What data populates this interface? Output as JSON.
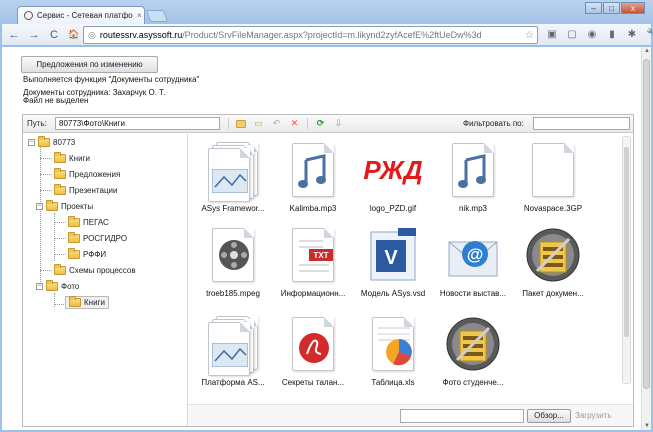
{
  "browser": {
    "tab_title": "Сервис - Сетевая платфор",
    "tab_close": "×",
    "url_host": "routessrv.asyssoft.ru",
    "url_path": "/Product/SrvFileManager.aspx?projectId=m.likynd2zyfAcefE%2ftUeDw%3d",
    "back": "←",
    "forward": "→",
    "reload": "C",
    "home": "🏠",
    "star": "☆",
    "window_buttons": [
      "–",
      "□",
      "x"
    ]
  },
  "page": {
    "suggest_button": "Предложения по изменению",
    "function_line": "Выполняется функция \"Документы сотрудника\"",
    "docs_line": "Документы сотрудника: Захарчук О. Т.",
    "file_status": "Файл не выделен"
  },
  "file_manager": {
    "path_label": "Путь:",
    "path_value": "80773\\Фото\\Книги",
    "filter_label": "Фильтровать по:",
    "tree": {
      "root": "80773",
      "items": [
        "Книги",
        "Предложения",
        "Презентации",
        "Проекты",
        "ПЕГАС",
        "РОСГИДРО",
        "РФФИ",
        "Схемы процессов",
        "Фото",
        "Книги"
      ]
    },
    "files": [
      {
        "name": "ASys Framewor...",
        "icon": "image-doc-icon"
      },
      {
        "name": "Kalimba.mp3",
        "icon": "audio-file-icon"
      },
      {
        "name": "logo_PZD.gif",
        "icon": "rzd-logo-icon"
      },
      {
        "name": "nik.mp3",
        "icon": "audio-file-icon"
      },
      {
        "name": "Novaspace.3GP",
        "icon": "blank-file-icon"
      },
      {
        "name": "troeb185.mpeg",
        "icon": "video-file-icon"
      },
      {
        "name": "Информационн...",
        "icon": "txt-file-icon"
      },
      {
        "name": "Модель ASys.vsd",
        "icon": "visio-file-icon"
      },
      {
        "name": "Новости выстав...",
        "icon": "email-file-icon"
      },
      {
        "name": "Пакет докумен...",
        "icon": "archive-file-icon"
      },
      {
        "name": "Платформа AS...",
        "icon": "image-doc-icon"
      },
      {
        "name": "Секреты талан...",
        "icon": "pdf-file-icon"
      },
      {
        "name": "Таблица.xls",
        "icon": "spreadsheet-file-icon"
      },
      {
        "name": "Фото студенче...",
        "icon": "archive-file-icon"
      }
    ],
    "browse_button": "Обзор...",
    "upload_button": "Загрузить"
  },
  "logo_text": "РЖД",
  "colors": {
    "accent": "#9dc1e8",
    "folder": "#f3cf6b",
    "pdf": "#d32b2b",
    "rzd": "#e21a1a"
  }
}
